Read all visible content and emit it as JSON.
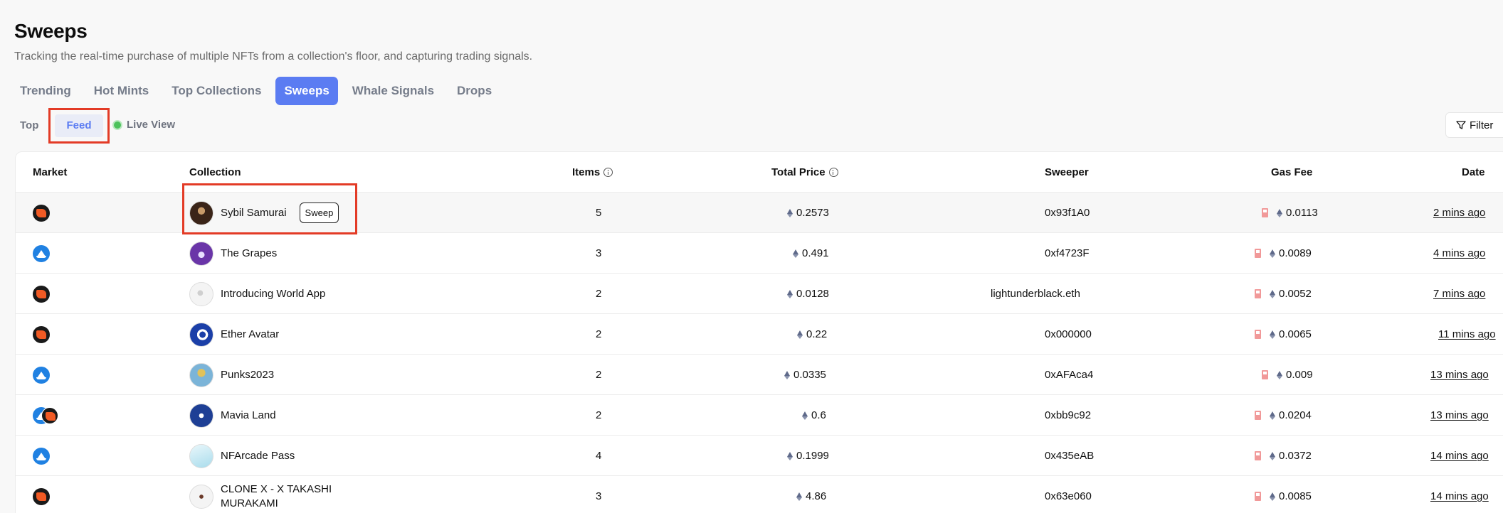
{
  "page": {
    "title": "Sweeps",
    "subtitle": "Tracking the real-time purchase of multiple NFTs from a collection's floor, and capturing trading signals."
  },
  "tabs": [
    "Trending",
    "Hot Mints",
    "Top Collections",
    "Sweeps",
    "Whale Signals",
    "Drops"
  ],
  "active_tab": "Sweeps",
  "subtabs": {
    "top": "Top",
    "feed": "Feed",
    "live_view": "Live View"
  },
  "filter_label": "Filter",
  "table": {
    "headers": {
      "market": "Market",
      "collection": "Collection",
      "items": "Items",
      "total_price": "Total Price",
      "sweeper": "Sweeper",
      "gas_fee": "Gas Fee",
      "date": "Date"
    },
    "sweep_badge": "Sweep",
    "rows": [
      {
        "market": [
          "blur"
        ],
        "collection": "Sybil Samurai",
        "items": "5",
        "total_price": "0.2573",
        "sweeper": "0x93f1A0",
        "gas_fee": "0.0113",
        "date": "2 mins ago"
      },
      {
        "market": [
          "opensea"
        ],
        "collection": "The Grapes",
        "items": "3",
        "total_price": "0.491",
        "sweeper": "0xf4723F",
        "gas_fee": "0.0089",
        "date": "4 mins ago"
      },
      {
        "market": [
          "blur"
        ],
        "collection": "Introducing World App",
        "items": "2",
        "total_price": "0.0128",
        "sweeper": "lightunderblack.eth",
        "gas_fee": "0.0052",
        "date": "7 mins ago"
      },
      {
        "market": [
          "blur"
        ],
        "collection": "Ether Avatar",
        "items": "2",
        "total_price": "0.22",
        "sweeper": "0x000000",
        "gas_fee": "0.0065",
        "date": "11 mins ago"
      },
      {
        "market": [
          "opensea"
        ],
        "collection": "Punks2023",
        "items": "2",
        "total_price": "0.0335",
        "sweeper": "0xAFAca4",
        "gas_fee": "0.009",
        "date": "13 mins ago"
      },
      {
        "market": [
          "opensea",
          "blur"
        ],
        "collection": "Mavia Land",
        "items": "2",
        "total_price": "0.6",
        "sweeper": "0xbb9c92",
        "gas_fee": "0.0204",
        "date": "13 mins ago"
      },
      {
        "market": [
          "opensea"
        ],
        "collection": "NFArcade Pass",
        "items": "4",
        "total_price": "0.1999",
        "sweeper": "0x435eAB",
        "gas_fee": "0.0372",
        "date": "14 mins ago"
      },
      {
        "market": [
          "blur"
        ],
        "collection": "CLONE X - X TAKASHI MURAKAMI",
        "items": "3",
        "total_price": "4.86",
        "sweeper": "0x63e060",
        "gas_fee": "0.0085",
        "date": "14 mins ago"
      }
    ]
  },
  "colors": {
    "accent": "#5b7cf2",
    "highlight_box": "#e33b26",
    "live_dot": "#4cc25b",
    "gas_icon": "#f19999"
  }
}
